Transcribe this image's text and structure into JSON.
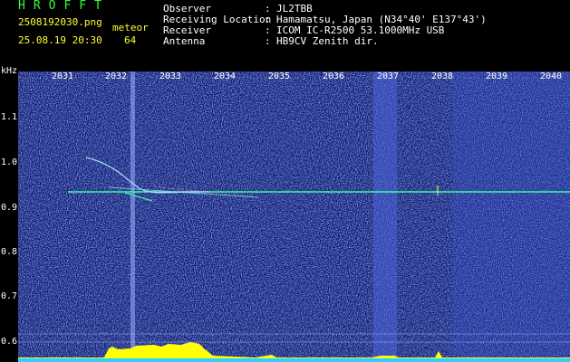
{
  "header": {
    "brand": "HROFFT",
    "filename": "2508192030.png",
    "event_type": "meteor",
    "datetime": "25.08.19 20:30",
    "count": "64",
    "fields": [
      {
        "label": "Observer",
        "value": "JL2TBB"
      },
      {
        "label": "Receiving Location",
        "value": "Hamamatsu, Japan (N34°40' E137°43')"
      },
      {
        "label": "Receiver",
        "value": "ICOM IC-R2500 53.1000MHz USB"
      },
      {
        "label": "Antenna",
        "value": "HB9CV Zenith dir."
      }
    ]
  },
  "spectrogram": {
    "y_unit": "kHz",
    "y_ticks": [
      "1.1",
      "1.0",
      "0.9",
      "0.8",
      "0.7",
      "0.6"
    ],
    "x_ticks": [
      "2031",
      "2032",
      "2033",
      "2034",
      "2035",
      "2036",
      "2037",
      "2038",
      "2039",
      "2040"
    ],
    "colors": {
      "background": "#0c1a6e",
      "noise_band": "#4a63d8",
      "carrier": "#33ff99",
      "level_bar": "#ffff00",
      "level_base": "#33ccff",
      "text_yellow": "#ffff33"
    }
  }
}
